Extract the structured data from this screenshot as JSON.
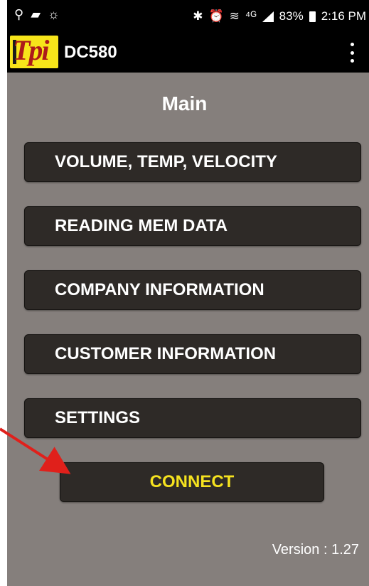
{
  "status_bar": {
    "left_icons": [
      "usb-icon",
      "message-icon",
      "sync-icon"
    ],
    "right_icons": [
      "bluetooth-icon",
      "alarm-icon",
      "wifi-icon",
      "network-icon",
      "signal-icon"
    ],
    "battery_percent": "83%",
    "time": "2:16 PM"
  },
  "app_bar": {
    "logo_text": "Tpi",
    "title": "DC580",
    "overflow_icon": "more-vert-icon"
  },
  "main": {
    "title": "Main",
    "menu_items": [
      {
        "label": "VOLUME, TEMP, VELOCITY"
      },
      {
        "label": "READING MEM DATA"
      },
      {
        "label": "COMPANY INFORMATION"
      },
      {
        "label": "CUSTOMER INFORMATION"
      },
      {
        "label": "SETTINGS"
      }
    ],
    "connect_label": "CONNECT",
    "version": "Version : 1.27"
  },
  "colors": {
    "background": "#857f7c",
    "button": "#2e2a27",
    "connect_text": "#f5e21f",
    "arrow": "#e0201b"
  }
}
